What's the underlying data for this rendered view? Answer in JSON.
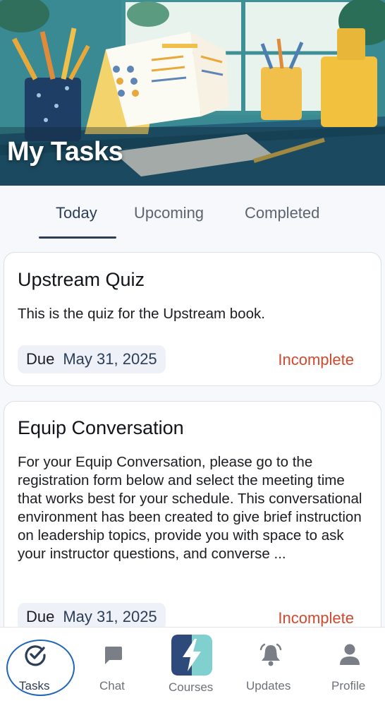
{
  "header": {
    "title": "My Tasks"
  },
  "tabs": [
    {
      "label": "Today",
      "active": true
    },
    {
      "label": "Upcoming",
      "active": false
    },
    {
      "label": "Completed",
      "active": false
    }
  ],
  "tasks": [
    {
      "title": "Upstream Quiz",
      "description": "This is the quiz for the Upstream book.",
      "due_label": "Due",
      "due_date": "May 31, 2025",
      "status": "Incomplete"
    },
    {
      "title": "Equip Conversation",
      "description": "For your Equip Conversation, please go to the registration form below and select the meeting time that works best for your schedule. This conversational environment has been created to give brief instruction on leadership topics, provide you with space to ask your instructor questions, and converse ...",
      "due_label": "Due",
      "due_date": "May 31, 2025",
      "status": "Incomplete"
    }
  ],
  "nav": {
    "items": [
      {
        "label": "Tasks",
        "icon": "check-circle-icon",
        "active": true
      },
      {
        "label": "Chat",
        "icon": "chat-bubble-icon",
        "active": false
      },
      {
        "label": "Courses",
        "icon": "courses-bolt-logo-icon",
        "active": false
      },
      {
        "label": "Updates",
        "icon": "bell-icon",
        "active": false
      },
      {
        "label": "Profile",
        "icon": "person-icon",
        "active": false
      }
    ]
  },
  "colors": {
    "accent": "#2c3e57",
    "status_incomplete": "#d2482c",
    "active_ring": "#1e66b8",
    "chip_bg": "#eef1f8"
  }
}
